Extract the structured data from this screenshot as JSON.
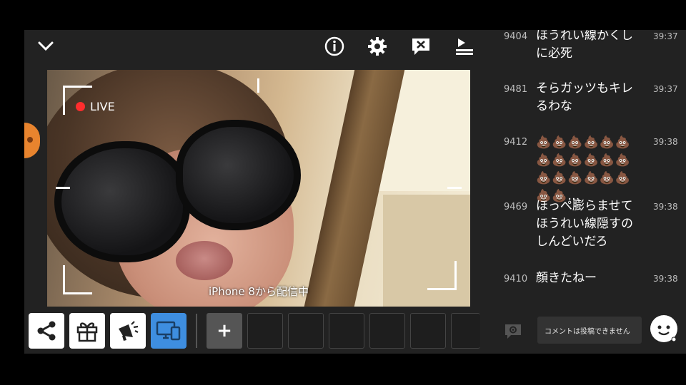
{
  "stream": {
    "live_label": "LIVE",
    "caption": "iPhone 8から配信中"
  },
  "topbar": {
    "icons": [
      "chevron-down-icon",
      "info-icon",
      "gear-icon",
      "comment-off-icon",
      "upload-icon"
    ]
  },
  "toolbar": {
    "add_label": "+",
    "buttons": [
      "share-icon",
      "gift-icon",
      "megaphone-icon",
      "screen-icon"
    ]
  },
  "comments": [
    {
      "num": "9404",
      "text": "ほうれい線かくしに必死",
      "time": "39:37"
    },
    {
      "num": "9481",
      "text": "そらガッツもキレるわな",
      "time": "39:37"
    },
    {
      "num": "9412",
      "text": "💩💩💩💩💩💩💩💩💩💩💩💩💩💩💩💩💩💩💩💩…",
      "time": "39:38"
    },
    {
      "num": "9469",
      "text": "ほっぺ膨らませてほうれい線隠すのしんどいだろ",
      "time": "39:38"
    },
    {
      "num": "9410",
      "text": "顔きたねー",
      "time": "39:38"
    }
  ],
  "input": {
    "placeholder": "コメントは投稿できません"
  },
  "colors": {
    "accent": "#3e8ee0",
    "live": "#ff2d2d",
    "panel": "#222222"
  }
}
